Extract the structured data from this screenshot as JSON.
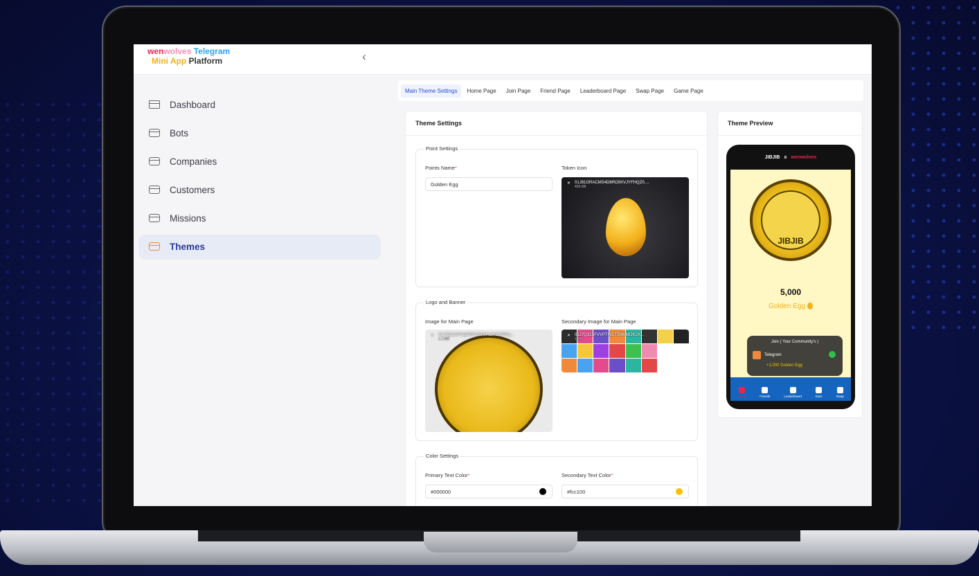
{
  "brand": {
    "w1": "wen",
    "w2": "wolves",
    "tg": " Telegram",
    "mini": "Mini App",
    "plat": " Platform"
  },
  "sidebar": {
    "items": [
      {
        "label": "Dashboard"
      },
      {
        "label": "Bots"
      },
      {
        "label": "Companies"
      },
      {
        "label": "Customers"
      },
      {
        "label": "Missions"
      },
      {
        "label": "Themes"
      }
    ]
  },
  "tabs": [
    "Main Theme Settings",
    "Home Page",
    "Join Page",
    "Friend Page",
    "Leaderboard Page",
    "Swap Page",
    "Game Page"
  ],
  "theme_settings": {
    "title": "Theme Settings",
    "point": {
      "legend": "Point Settings",
      "points_label": "Points Name",
      "points_value": "Golden Egg",
      "token_label": "Token Icon",
      "token_file": "01J81GRACMS4D6RO9XVJYFHQZ0....",
      "token_size": "455 KB"
    },
    "logo": {
      "legend": "Logo and Banner",
      "main_label": "Image for Main Page",
      "main_file": "01J7Q31SFSQ5R8CWRW1ZY5Y5RB.j...",
      "main_size": "1.1 MB",
      "secondary_label": "Secondary Image for Main Page",
      "secondary_file": "01J7Q31SFVVPTWDTS9M682K2X...",
      "secondary_size": "1 KB"
    },
    "color": {
      "legend": "Color Settings",
      "primary_label": "Primary Text Color",
      "primary_value": "#000000",
      "secondary_label": "Secondary Text Color",
      "secondary_value": "#fcc100"
    }
  },
  "preview": {
    "title": "Theme Preview",
    "header_left": "JIBJIB",
    "header_x": "x",
    "header_right": "wenwolves",
    "coin_text": "JIBJIB",
    "value": "5,000",
    "unit": "Golden Egg",
    "join_title": "Join ( Your Community's )",
    "join_item": "Telegram",
    "join_reward": "+1,000 Golden Egg",
    "nav": [
      "Home",
      "Friends",
      "Leaderboard",
      "Earn",
      "Swap"
    ]
  },
  "colors": {
    "accent": "#2a4ad0",
    "active_bg": "#e6ebf5",
    "swatch_primary": "#000000",
    "swatch_secondary": "#fcc100"
  }
}
